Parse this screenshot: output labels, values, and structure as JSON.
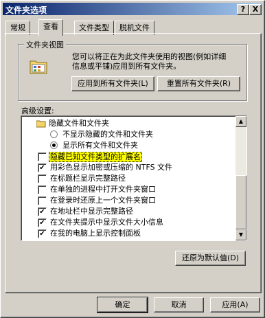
{
  "window": {
    "title": "文件夹选项",
    "help_label": "?",
    "close_label": "X"
  },
  "tabs": [
    {
      "label": "常规",
      "active": false
    },
    {
      "label": "查看",
      "active": true
    },
    {
      "label": "文件类型",
      "active": false
    },
    {
      "label": "脱机文件",
      "active": false
    }
  ],
  "folder_views": {
    "label": "文件夹视图",
    "description_line1": "您可以将正在为此文件夹使用的视图(例如详细",
    "description_line2": "信息或平铺)应用到所有文件夹。",
    "apply_all_button": "应用到所有文件夹(L)",
    "reset_all_button": "重置所有文件夹(R)"
  },
  "advanced": {
    "label": "高级设置:",
    "items": [
      {
        "type": "folder",
        "label": "隐藏文件和文件夹"
      },
      {
        "type": "radio",
        "checked": false,
        "label": "不显示隐藏的文件和文件夹"
      },
      {
        "type": "radio",
        "checked": true,
        "label": "显示所有文件和文件夹"
      },
      {
        "type": "checkbox",
        "checked": false,
        "label": "隐藏已知文件类型的扩展名",
        "highlight": true
      },
      {
        "type": "checkbox",
        "checked": true,
        "label": "用彩色显示加密或压缩的 NTFS 文件"
      },
      {
        "type": "checkbox",
        "checked": false,
        "label": "在标题栏显示完整路径"
      },
      {
        "type": "checkbox",
        "checked": false,
        "label": "在单独的进程中打开文件夹窗口"
      },
      {
        "type": "checkbox",
        "checked": false,
        "label": "在登录时还原上一个文件夹窗口"
      },
      {
        "type": "checkbox",
        "checked": true,
        "label": "在地址栏中显示完整路径"
      },
      {
        "type": "checkbox",
        "checked": true,
        "label": "在文件夹提示中显示文件大小信息"
      },
      {
        "type": "checkbox",
        "checked": true,
        "label": "在我的电脑上显示控制面板"
      }
    ],
    "restore_defaults_button": "还原为默认值(D)",
    "scroll_up": "▲",
    "scroll_down": "▼",
    "check_mark": "✔"
  },
  "footer": {
    "ok_button": "确定",
    "cancel_button": "取消",
    "apply_button": "应用(A)"
  }
}
